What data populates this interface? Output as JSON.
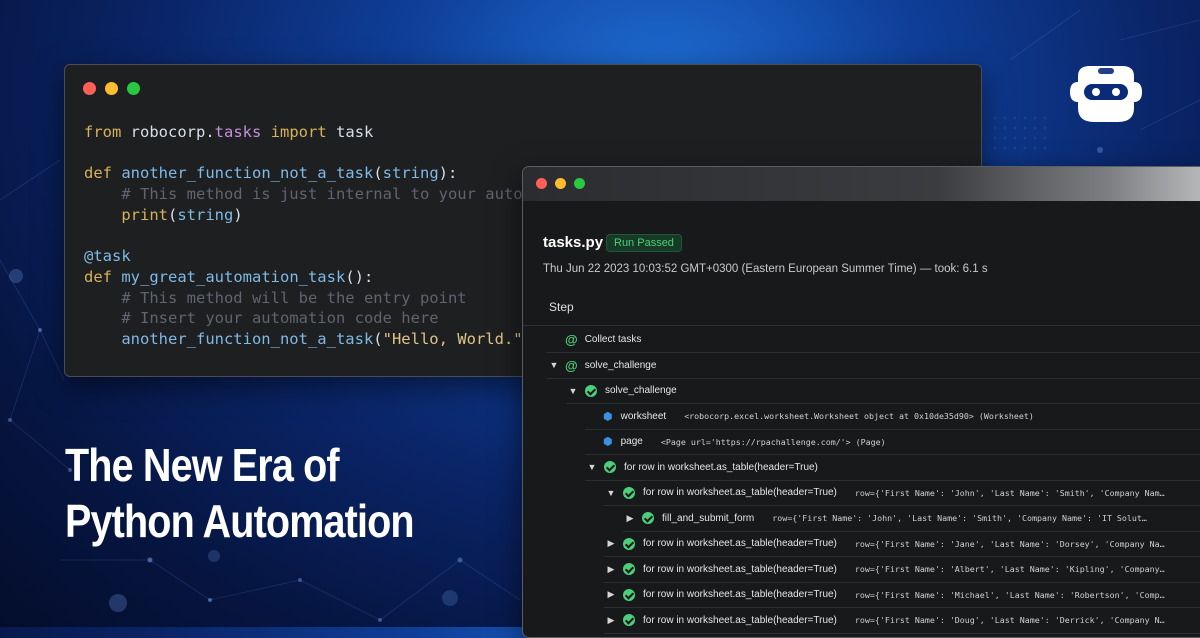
{
  "editor": {
    "lines": [
      "from robocorp.tasks import task",
      "",
      "def another_function_not_a_task(string):",
      "    # This method is just internal to your auto",
      "    print(string)",
      "",
      "@task",
      "def my_great_automation_task():",
      "    # This method will be the entry point",
      "    # Insert your automation code here",
      "    another_function_not_a_task(\"Hello, World.\""
    ]
  },
  "report": {
    "file_name": "tasks.py",
    "status": "Run Passed",
    "meta": "Thu Jun 22 2023 10:03:52 GMT+0300 (Eastern European Summer Time) — took: 6.1 s",
    "step_header": "Step",
    "rows": [
      {
        "indent": 0,
        "caret": "",
        "icon": "at",
        "label": "Collect tasks",
        "detail": ""
      },
      {
        "indent": 0,
        "caret": "down",
        "icon": "at",
        "label": "solve_challenge",
        "detail": ""
      },
      {
        "indent": 1,
        "caret": "down",
        "icon": "check",
        "label": "solve_challenge",
        "detail": ""
      },
      {
        "indent": 2,
        "caret": "",
        "icon": "cube",
        "label": "worksheet",
        "detail": "<robocorp.excel.worksheet.Worksheet object at 0x10de35d90> (Worksheet)"
      },
      {
        "indent": 2,
        "caret": "",
        "icon": "cube",
        "label": "page",
        "detail": "<Page url='https://rpachallenge.com/'> (Page)"
      },
      {
        "indent": 2,
        "caret": "down",
        "icon": "check",
        "label": "for row in worksheet.as_table(header=True)",
        "detail": ""
      },
      {
        "indent": 3,
        "caret": "down",
        "icon": "check",
        "label": "for row in worksheet.as_table(header=True)",
        "detail": "row={'First Name': 'John', 'Last Name': 'Smith', 'Company Nam…"
      },
      {
        "indent": 4,
        "caret": "right",
        "icon": "check",
        "label": "fill_and_submit_form",
        "detail": "row={'First Name': 'John', 'Last Name': 'Smith', 'Company Name': 'IT Solut…"
      },
      {
        "indent": 3,
        "caret": "right",
        "icon": "check",
        "label": "for row in worksheet.as_table(header=True)",
        "detail": "row={'First Name': 'Jane', 'Last Name': 'Dorsey', 'Company Na…"
      },
      {
        "indent": 3,
        "caret": "right",
        "icon": "check",
        "label": "for row in worksheet.as_table(header=True)",
        "detail": "row={'First Name': 'Albert', 'Last Name': 'Kipling', 'Company…"
      },
      {
        "indent": 3,
        "caret": "right",
        "icon": "check",
        "label": "for row in worksheet.as_table(header=True)",
        "detail": "row={'First Name': 'Michael', 'Last Name': 'Robertson', 'Comp…"
      },
      {
        "indent": 3,
        "caret": "right",
        "icon": "check",
        "label": "for row in worksheet.as_table(header=True)",
        "detail": "row={'First Name': 'Doug', 'Last Name': 'Derrick', 'Company N…"
      }
    ]
  },
  "headline": {
    "line1": "The New Era of",
    "line2": "Python Automation"
  },
  "logo": {
    "icon": "robocorp-logo-icon"
  },
  "colors": {
    "accent_green": "#4ccf7a",
    "cube_blue": "#3d8fe0",
    "background_blue": "#0f3f99"
  }
}
